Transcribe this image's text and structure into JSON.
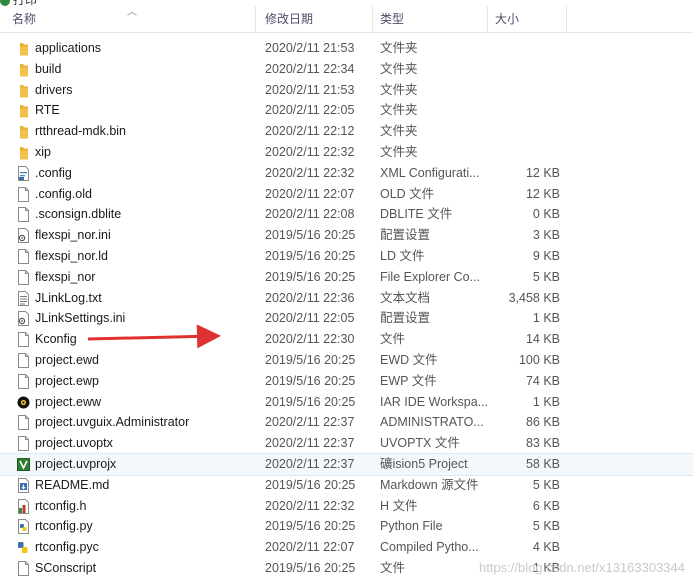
{
  "top_partial": "打印",
  "header": {
    "name": "名称",
    "modified": "修改日期",
    "type": "类型",
    "size": "大小"
  },
  "files": [
    {
      "name": "applications",
      "date": "2020/2/11 21:53",
      "type": "文件夹",
      "size": "",
      "icon": "folder-icon"
    },
    {
      "name": "build",
      "date": "2020/2/11 22:34",
      "type": "文件夹",
      "size": "",
      "icon": "folder-icon"
    },
    {
      "name": "drivers",
      "date": "2020/2/11 21:53",
      "type": "文件夹",
      "size": "",
      "icon": "folder-icon"
    },
    {
      "name": "RTE",
      "date": "2020/2/11 22:05",
      "type": "文件夹",
      "size": "",
      "icon": "folder-icon"
    },
    {
      "name": "rtthread-mdk.bin",
      "date": "2020/2/11 22:12",
      "type": "文件夹",
      "size": "",
      "icon": "folder-icon"
    },
    {
      "name": "xip",
      "date": "2020/2/11 22:32",
      "type": "文件夹",
      "size": "",
      "icon": "folder-icon"
    },
    {
      "name": ".config",
      "date": "2020/2/11 22:32",
      "type": "XML Configurati...",
      "size": "12 KB",
      "icon": "xml-file-icon"
    },
    {
      "name": ".config.old",
      "date": "2020/2/11 22:07",
      "type": "OLD 文件",
      "size": "12 KB",
      "icon": "file-icon"
    },
    {
      "name": ".sconsign.dblite",
      "date": "2020/2/11 22:08",
      "type": "DBLITE 文件",
      "size": "0 KB",
      "icon": "file-icon"
    },
    {
      "name": "flexspi_nor.ini",
      "date": "2019/5/16 20:25",
      "type": "配置设置",
      "size": "3 KB",
      "icon": "settings-file-icon"
    },
    {
      "name": "flexspi_nor.ld",
      "date": "2019/5/16 20:25",
      "type": "LD 文件",
      "size": "9 KB",
      "icon": "file-icon"
    },
    {
      "name": "flexspi_nor",
      "date": "2019/5/16 20:25",
      "type": "File Explorer Co...",
      "size": "5 KB",
      "icon": "file-icon"
    },
    {
      "name": "JLinkLog.txt",
      "date": "2020/2/11 22:36",
      "type": "文本文档",
      "size": "3,458 KB",
      "icon": "text-file-icon"
    },
    {
      "name": "JLinkSettings.ini",
      "date": "2020/2/11 22:05",
      "type": "配置设置",
      "size": "1 KB",
      "icon": "settings-file-icon"
    },
    {
      "name": "Kconfig",
      "date": "2020/2/11 22:30",
      "type": "文件",
      "size": "14 KB",
      "icon": "file-icon"
    },
    {
      "name": "project.ewd",
      "date": "2019/5/16 20:25",
      "type": "EWD 文件",
      "size": "100 KB",
      "icon": "file-icon"
    },
    {
      "name": "project.ewp",
      "date": "2019/5/16 20:25",
      "type": "EWP 文件",
      "size": "74 KB",
      "icon": "file-icon"
    },
    {
      "name": "project.eww",
      "date": "2019/5/16 20:25",
      "type": "IAR IDE Workspa...",
      "size": "1 KB",
      "icon": "iar-workspace-icon"
    },
    {
      "name": "project.uvguix.Administrator",
      "date": "2020/2/11 22:37",
      "type": "ADMINISTRATO...",
      "size": "86 KB",
      "icon": "file-icon"
    },
    {
      "name": "project.uvoptx",
      "date": "2020/2/11 22:37",
      "type": "UVOPTX 文件",
      "size": "83 KB",
      "icon": "file-icon"
    },
    {
      "name": "project.uvprojx",
      "date": "2020/2/11 22:37",
      "type": "礦ision5 Project",
      "size": "58 KB",
      "icon": "uvision-project-icon",
      "selected": true
    },
    {
      "name": "README.md",
      "date": "2019/5/16 20:25",
      "type": "Markdown 源文件",
      "size": "5 KB",
      "icon": "markdown-file-icon"
    },
    {
      "name": "rtconfig.h",
      "date": "2020/2/11 22:32",
      "type": "H 文件",
      "size": "6 KB",
      "icon": "header-file-icon"
    },
    {
      "name": "rtconfig.py",
      "date": "2019/5/16 20:25",
      "type": "Python File",
      "size": "5 KB",
      "icon": "python-file-icon"
    },
    {
      "name": "rtconfig.pyc",
      "date": "2020/2/11 22:07",
      "type": "Compiled Pytho...",
      "size": "4 KB",
      "icon": "python-compiled-icon"
    },
    {
      "name": "SConscript",
      "date": "2019/5/16 20:25",
      "type": "文件",
      "size": "1 KB",
      "icon": "file-icon"
    }
  ],
  "annotation": {
    "target": "Kconfig",
    "color": "#e03131"
  },
  "watermark": "https://blog.csdn.net/x13163303344"
}
